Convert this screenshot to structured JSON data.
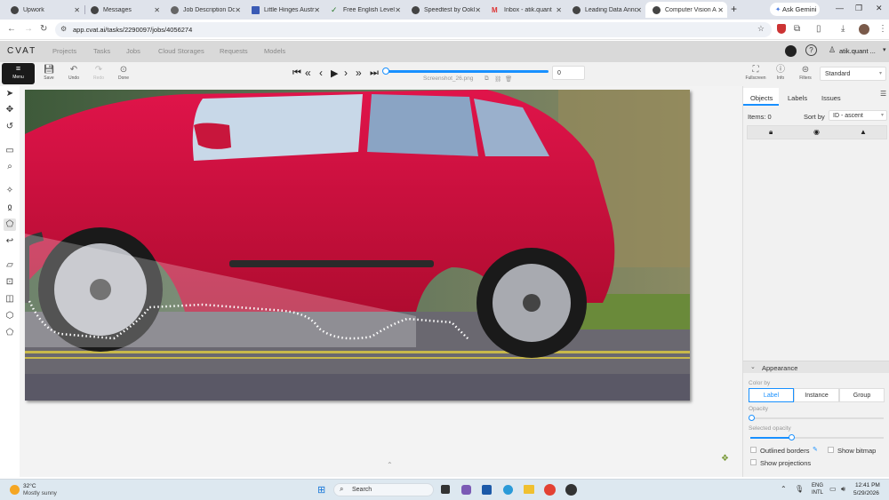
{
  "browser": {
    "tabs": [
      {
        "title": "Upwork",
        "active": false
      },
      {
        "title": "Messages",
        "active": false
      },
      {
        "title": "Job Description Do",
        "active": false
      },
      {
        "title": "Little Hinges Austr",
        "active": false
      },
      {
        "title": "Free English Level",
        "active": false
      },
      {
        "title": "Speedtest by Ookl",
        "active": false
      },
      {
        "title": "Inbox - atik.quant",
        "active": false
      },
      {
        "title": "Leading Data Anno",
        "active": false
      },
      {
        "title": "Computer Vision A",
        "active": true
      }
    ],
    "ask_gemini": "Ask Gemini",
    "url": "app.cvat.ai/tasks/2290097/jobs/4056274"
  },
  "cvat": {
    "logo": "CVAT",
    "nav": [
      "Projects",
      "Tasks",
      "Jobs",
      "Cloud Storages",
      "Requests",
      "Models"
    ],
    "user": "atik.quant ...",
    "toolbar": {
      "menu": "Menu",
      "save": "Save",
      "undo": "Undo",
      "redo": "Redo",
      "done": "Done",
      "frame_number": "0",
      "filename": "Screenshot_26.png",
      "fullscreen": "Fullscreen",
      "info": "Info",
      "filters": "Filters",
      "workspace": "Standard"
    },
    "sidebar": {
      "tabs": [
        "Objects",
        "Labels",
        "Issues"
      ],
      "items_count": "Items: 0",
      "sort_by_label": "Sort by",
      "sort_value": "ID - ascent",
      "appearance_title": "Appearance",
      "color_by_label": "Color by",
      "color_by_options": [
        "Label",
        "Instance",
        "Group"
      ],
      "opacity_label": "Opacity",
      "opacity_value": 0.0,
      "selected_opacity_label": "Selected opacity",
      "selected_opacity_value": 0.5,
      "outlined_borders": "Outlined borders",
      "show_bitmap": "Show bitmap",
      "show_projections": "Show projections"
    }
  },
  "taskbar": {
    "temperature": "32°C",
    "weather": "Mostly sunny",
    "search": "Search",
    "lang1": "ENG",
    "lang2": "INTL",
    "time": "12:41 PM",
    "date": "5/29/2026"
  },
  "colors": {
    "accent_blue": "#1890ff",
    "car_red": "#d8143c"
  }
}
